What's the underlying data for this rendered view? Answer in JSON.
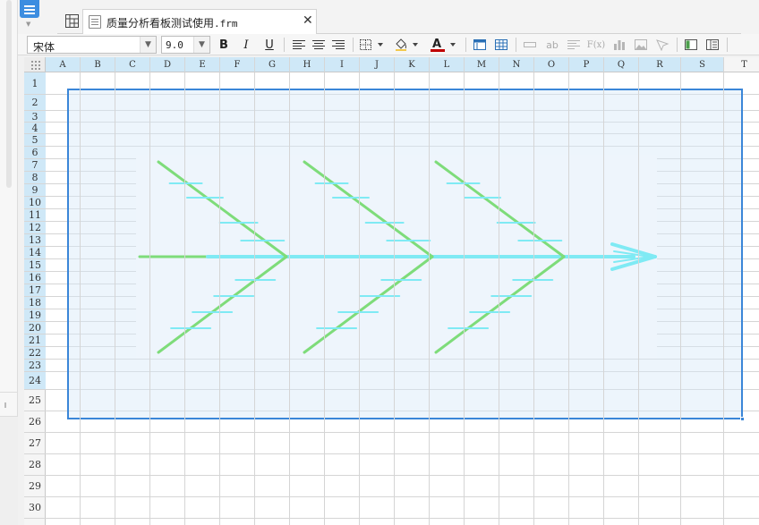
{
  "tab": {
    "title": "质量分析看板测试使用",
    "ext": ".frm"
  },
  "toolbar": {
    "font_family": "宋体",
    "font_size": "9.0",
    "bold": "B",
    "italic": "I",
    "underline": "U",
    "font_color": "#c00000",
    "text_wrap_label": "ab",
    "formula_label": "F(x)"
  },
  "sheet": {
    "columns": [
      "A",
      "B",
      "C",
      "D",
      "E",
      "F",
      "G",
      "H",
      "I",
      "J",
      "K",
      "L",
      "M",
      "N",
      "O",
      "P",
      "Q",
      "R",
      "S",
      "T"
    ],
    "rows": [
      "1",
      "2",
      "3",
      "4",
      "5",
      "6",
      "7",
      "8",
      "9",
      "10",
      "11",
      "12",
      "13",
      "14",
      "15",
      "16",
      "17",
      "18",
      "19",
      "20",
      "21",
      "22",
      "23",
      "24",
      "25",
      "26",
      "27",
      "28",
      "29",
      "30"
    ],
    "selection": "A1:S24"
  },
  "chart": {
    "type": "fishbone diagram",
    "bone_colors": [
      "#7edc7a",
      "#7feaf4"
    ]
  },
  "icons": [
    "app-menu-icon",
    "sheet-grid-icon",
    "file-icon",
    "close-icon",
    "border-icon",
    "fill-color-icon",
    "font-color-icon",
    "freeze-icon",
    "table-icon",
    "merge-icon",
    "text-wrap-icon",
    "align-icon",
    "formula-icon",
    "chart-icon",
    "image-icon",
    "pen-icon",
    "panel-icon",
    "sheet-list-icon"
  ]
}
